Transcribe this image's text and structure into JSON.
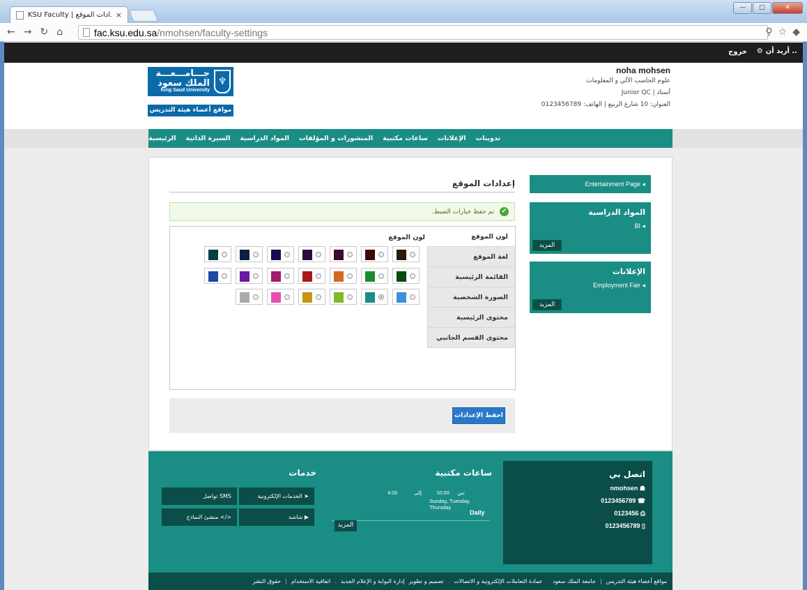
{
  "browser": {
    "tab_title": "KSU Faculty | إعدادات الموقع",
    "url_host": "fac.ksu.edu.sa",
    "url_path": "/nmohsen/faculty-settings",
    "close_glyph": "×"
  },
  "topbar": {
    "want_label": "أريد أن ..",
    "logout_label": "خروج"
  },
  "profile": {
    "name": "noha mohsen",
    "department": "علوم الحاسب الآلي و المعلومات",
    "title_line": "أستاذ | Junior QC",
    "address_line": "العنوان: 10 شارع الربيع | الهاتف: 0123456789"
  },
  "logo": {
    "arabic": "جـــامـــعـــة الملك سعود",
    "english": "King Saud University",
    "sites_label": "مواقع أعضاء هيئة التدريس"
  },
  "nav": {
    "items": [
      "الرئيسية",
      "السيرة الذاتية",
      "المواد الدراسية",
      "المنشورات و المؤلفات",
      "ساعات مكتبية",
      "الإعلانات",
      "تدوينات"
    ]
  },
  "settings": {
    "page_title": "إعدادات الموقع",
    "success_msg": "تم حفظ خيارات الضبط.",
    "tabs": [
      "لون الموقع",
      "لغة الموقع",
      "القائمة الرئيسية",
      "الصورة الشخصية",
      "محتوى الرئيسية",
      "محتوى القسم الجانبي"
    ],
    "pane_label": "لون الموقع",
    "save_label": "احفظ الإعدادات",
    "colors": [
      [
        "#2b1a06",
        "#3b0a0a",
        "#3a0b2b",
        "#2a0a3f",
        "#1a0a55",
        "#0b1f44",
        "#043f44"
      ],
      [
        "#0a4a0c",
        "#1e8a2f",
        "#d4681e",
        "#a81a1a",
        "#a31870",
        "#6a1aa3",
        "#1a4aa3"
      ],
      [
        "#3f8fe0",
        "#1a8d85",
        "#7fb82a",
        "#c8950f",
        "#e84cb3",
        "#aaaaaa"
      ]
    ],
    "selected_color": "#1a8d85"
  },
  "sidebar": {
    "entertainment": "Entertainment Page",
    "courses_title": "المواد الدراسية",
    "courses_item": "BI",
    "more_label": "المزيد",
    "ads_title": "الإعلانات",
    "ads_item": "Employment Fair"
  },
  "footer": {
    "contact_title": "اتصل بي",
    "contact_lines": [
      "nmohsen",
      "0123456789",
      "0123456",
      "0123456789"
    ],
    "office_title": "ساعات مكتبية",
    "office_from": "من:",
    "office_from_time": "10:00",
    "office_to": "إلى:",
    "office_to_time": "4:00",
    "office_days": "Sunday, Tuesday, Thursday",
    "office_freq": "Daily",
    "office_more": "المزيد",
    "services_title": "خدمات",
    "services": [
      "الخدمات الإلكترونية",
      "SMS تواصل",
      "شاشة",
      "</> منشئ النماذج"
    ],
    "bottom_links": [
      "مواقع أعضاء هيئة التدريس",
      "جامعة الملك سعود",
      "عمادة التعاملات الإلكترونية و الاتصالات",
      "تصميم و تطوير",
      "إدارة البوابة و الإعلام الجديد",
      "اتفاقية الاستخدام",
      "حقوق النشر"
    ]
  }
}
